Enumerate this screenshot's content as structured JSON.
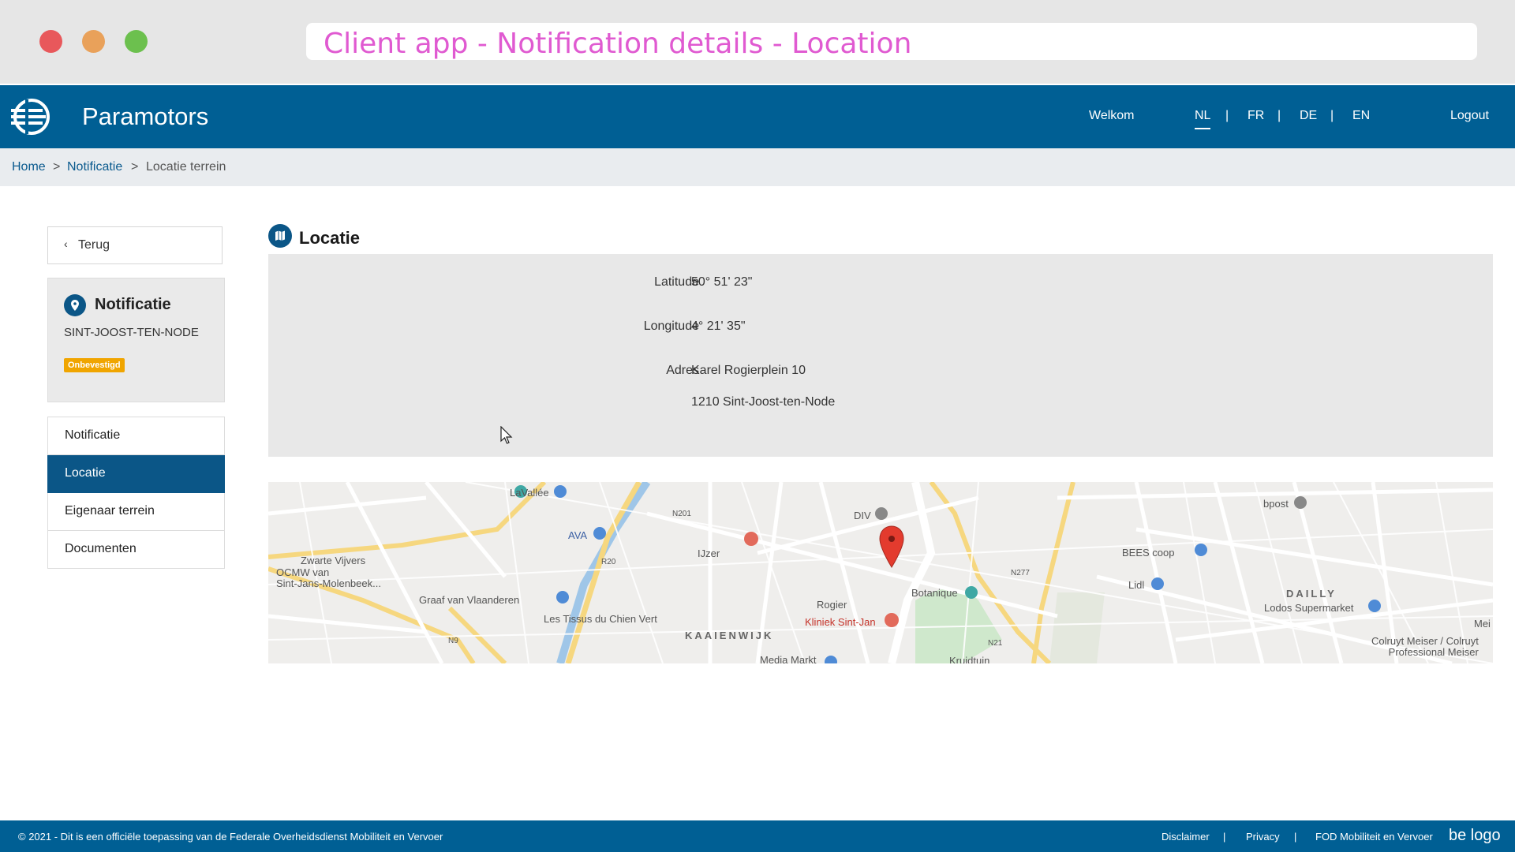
{
  "window": {
    "title": "Client app - Notification details - Location"
  },
  "header": {
    "app_name": "Paramotors",
    "welcome": "Welkom",
    "languages": [
      "NL",
      "FR",
      "DE",
      "EN"
    ],
    "lang_separator": "|",
    "active_language": "NL",
    "logout": "Logout"
  },
  "breadcrumb": {
    "home": "Home",
    "notification": "Notificatie",
    "current": "Locatie terrein",
    "separator": ">"
  },
  "sidebar": {
    "back_label": "Terug",
    "card": {
      "title": "Notificatie",
      "subtitle": "SINT-JOOST-TEN-NODE",
      "badge": "Onbevestigd"
    },
    "menu": [
      {
        "label": "Notificatie",
        "active": false
      },
      {
        "label": "Locatie",
        "active": true
      },
      {
        "label": "Eigenaar terrein",
        "active": false
      },
      {
        "label": "Documenten",
        "active": false
      }
    ]
  },
  "main": {
    "title": "Locatie",
    "fields": {
      "latitude_label": "Latitude",
      "latitude_value": "50° 51' 23\"",
      "longitude_label": "Longitude",
      "longitude_value": "4° 21' 35\"",
      "address_label": "Adres",
      "address_line1": "Karel Rogierplein  10",
      "address_line2": "1210  Sint-Joost-ten-Node"
    }
  },
  "map": {
    "labels": {
      "lavallee": "LaVallée",
      "div": "DIV",
      "bpost": "bpost",
      "ava": "AVA",
      "ijzer": "IJzer",
      "zwarte_vijvers": "Zwarte Vijvers",
      "ocmw": "OCMW van\nSint-Jans-Molenbeek...",
      "graaf": "Graaf van Vlaanderen",
      "tissus": "Les Tissus du Chien Vert",
      "kaaienwijk": "KAAIENWIJK",
      "rogier": "Rogier",
      "kliniek": "Kliniek Sint-Jan",
      "botanique": "Botanique",
      "bees": "BEES coop",
      "lidl": "Lidl",
      "dailly": "DAILLY",
      "lodos": "Lodos Supermarket",
      "colruyt": "Colruyt Meiser / Colruyt\nProfessional Meiser",
      "media": "Media Markt",
      "kruidtuin": "Kruidtuin",
      "r20": "R20",
      "n201": "N201",
      "n277": "N277",
      "n21": "N21",
      "n9": "N9",
      "mei": "Mei"
    },
    "marker_color": "#e33b2e"
  },
  "footer": {
    "copyright": "© 2021 - Dit is een officiële toepassing van de Federale Overheidsdienst Mobiliteit en Vervoer",
    "disclaimer": "Disclaimer",
    "privacy": "Privacy",
    "fod": "FOD Mobiliteit en Vervoer",
    "separator": "|",
    "logo_alt": "be logo"
  },
  "colors": {
    "primary": "#005f94",
    "active_menu": "#0b5687",
    "badge": "#f0a500",
    "title_accent": "#e05ad1"
  }
}
